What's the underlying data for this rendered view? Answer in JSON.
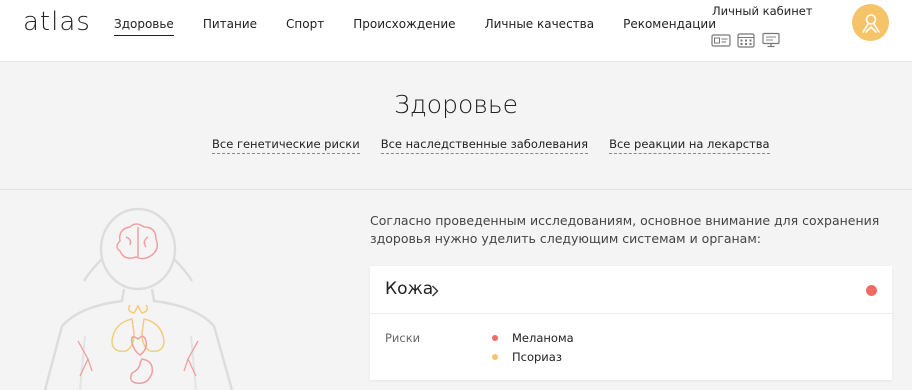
{
  "header": {
    "logo": "atlas",
    "nav": [
      "Здоровье",
      "Питание",
      "Спорт",
      "Происхождение",
      "Личные качества",
      "Рекомендации"
    ],
    "active_nav": "Здоровье",
    "cabinet_label": "Личный кабинет",
    "cabinet_icons": [
      "id-card-icon",
      "calendar-icon",
      "monitor-icon"
    ],
    "avatar_icon": "user-avatar-icon",
    "avatar_color": "#f6c468"
  },
  "hero": {
    "title": "Здоровье",
    "subtabs": [
      "Все генетические риски",
      "Все наследственные заболевания",
      "Все реакции на лекарства"
    ]
  },
  "main": {
    "intro": "Согласно проведенным исследованиям, основное внимание для сохранения здоровья нужно уделить следующим системам и органам:",
    "card": {
      "title": "Кожа",
      "status_color": "#ef6c64",
      "risks_label": "Риски",
      "risks": [
        {
          "name": "Меланома",
          "color": "#ef6c64"
        },
        {
          "name": "Псориаз",
          "color": "#f6c468"
        }
      ]
    }
  }
}
